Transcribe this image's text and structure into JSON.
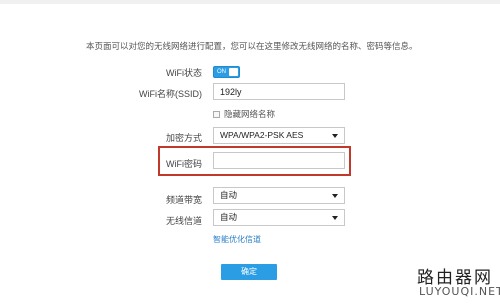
{
  "description": "本页面可以对您的无线网络进行配置，您可以在这里修改无线网络的名称、密码等信息。",
  "wifi_status": {
    "label": "WiFi状态",
    "toggle_text": "ON",
    "on": true
  },
  "ssid": {
    "label": "WiFi名称(SSID)",
    "value": "192ly"
  },
  "hide_network": {
    "label": "隐藏网络名称",
    "checked": false
  },
  "encryption": {
    "label": "加密方式",
    "value": "WPA/WPA2-PSK AES"
  },
  "password": {
    "label": "WiFi密码",
    "value": ""
  },
  "bandwidth": {
    "label": "频道带宽",
    "value": "自动"
  },
  "channel": {
    "label": "无线信道",
    "value": "自动"
  },
  "smart_optimize": "智能优化信道",
  "confirm_label": "确定",
  "watermark": {
    "cn": "路由器网",
    "en": "LUYOUQI.NET"
  },
  "colors": {
    "accent": "#2a9de4",
    "highlight": "#c0392b",
    "link": "#2a7fc9"
  }
}
